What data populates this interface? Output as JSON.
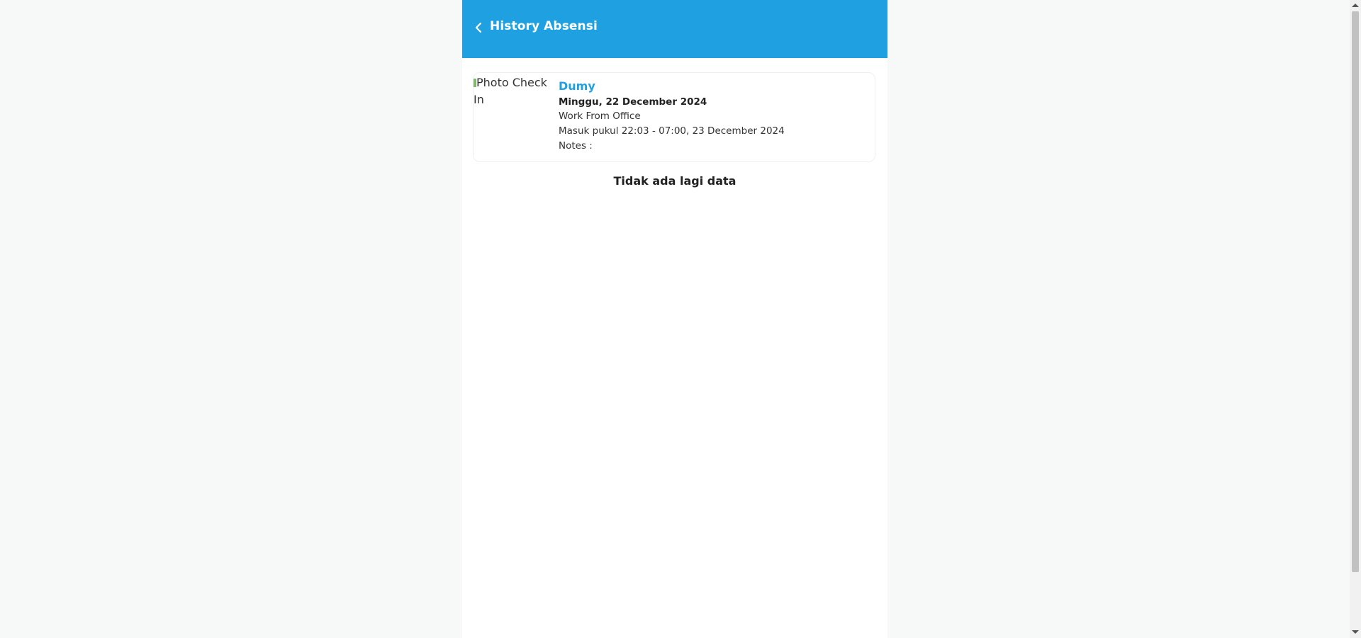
{
  "header": {
    "title": "History Absensi",
    "back_icon": "chevron-left-icon",
    "background_color": "#1fa0e0"
  },
  "attendance": [
    {
      "photo_alt": "Photo Check In",
      "name": "Dumy",
      "date": "Minggu, 22 December 2024",
      "work_type": "Work From Office",
      "check_in": "Masuk pukul 22:03 - 07:00, 23 December 2024",
      "notes": "Notes :"
    }
  ],
  "end_message": "Tidak ada lagi data",
  "accent_color": "#1fa0e0"
}
